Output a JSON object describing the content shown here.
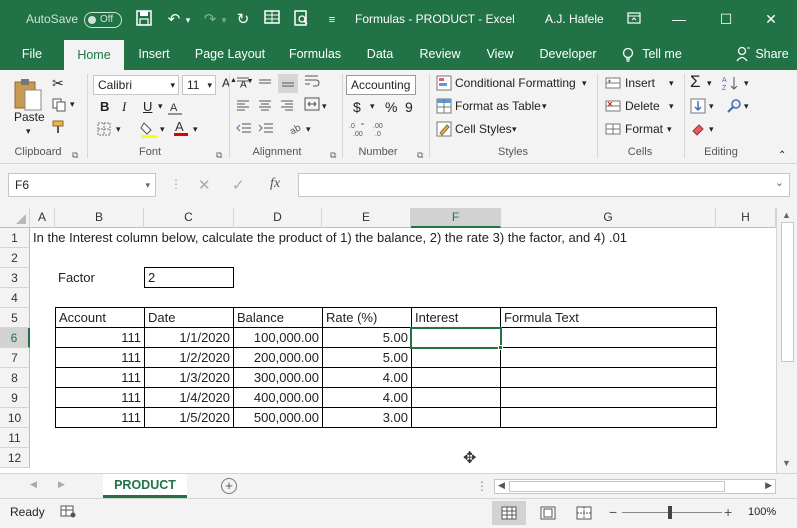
{
  "titlebar": {
    "autosave_label": "AutoSave",
    "autosave_state": "Off",
    "document_title": "Formulas - PRODUCT  -  Excel",
    "user": "A.J. Hafele"
  },
  "tabs": [
    {
      "label": "File"
    },
    {
      "label": "Home"
    },
    {
      "label": "Insert"
    },
    {
      "label": "Page Layout"
    },
    {
      "label": "Formulas"
    },
    {
      "label": "Data"
    },
    {
      "label": "Review"
    },
    {
      "label": "View"
    },
    {
      "label": "Developer"
    },
    {
      "label": "Tell me"
    },
    {
      "label": "Share"
    }
  ],
  "ribbon": {
    "clipboard": {
      "label": "Clipboard",
      "paste": "Paste"
    },
    "font": {
      "label": "Font",
      "name": "Calibri",
      "size": "11",
      "bold": "B",
      "italic": "I",
      "underline": "U"
    },
    "alignment": {
      "label": "Alignment"
    },
    "number": {
      "label": "Number",
      "format": "Accounting",
      "currency": "$",
      "percent": "%",
      "comma": "9"
    },
    "styles": {
      "label": "Styles",
      "conditional": "Conditional Formatting",
      "table": "Format as Table",
      "cell_styles": "Cell Styles"
    },
    "cells": {
      "label": "Cells",
      "insert": "Insert",
      "delete": "Delete",
      "format": "Format"
    },
    "editing": {
      "label": "Editing"
    }
  },
  "formula_bar": {
    "name_box": "F6",
    "fx": "fx",
    "content": ""
  },
  "columns": [
    "A",
    "B",
    "C",
    "D",
    "E",
    "F",
    "G",
    "H"
  ],
  "rows": [
    "1",
    "2",
    "3",
    "4",
    "5",
    "6",
    "7",
    "8",
    "9",
    "10",
    "11",
    "12"
  ],
  "sheet": {
    "instruction": "In the Interest column below, calculate the product of 1) the balance, 2) the rate 3) the factor, and 4) .01",
    "factor_label": "Factor",
    "factor_value": "2",
    "table_headers": [
      "Account",
      "Date",
      "Balance",
      "Rate (%)",
      "Interest",
      "Formula Text"
    ],
    "table_rows": [
      {
        "account": "111",
        "date": "1/1/2020",
        "balance": "100,000.00",
        "rate": "5.00",
        "interest": "",
        "formula": ""
      },
      {
        "account": "111",
        "date": "1/2/2020",
        "balance": "200,000.00",
        "rate": "5.00",
        "interest": "",
        "formula": ""
      },
      {
        "account": "111",
        "date": "1/3/2020",
        "balance": "300,000.00",
        "rate": "4.00",
        "interest": "",
        "formula": ""
      },
      {
        "account": "111",
        "date": "1/4/2020",
        "balance": "400,000.00",
        "rate": "4.00",
        "interest": "",
        "formula": ""
      },
      {
        "account": "111",
        "date": "1/5/2020",
        "balance": "500,000.00",
        "rate": "3.00",
        "interest": "",
        "formula": ""
      }
    ]
  },
  "sheet_tabs": [
    {
      "label": "PRODUCT"
    }
  ],
  "status": {
    "state": "Ready",
    "zoom": "100%"
  },
  "colors": {
    "brand": "#217346",
    "ribbon": "#f3f3f3",
    "selection": "#217346"
  }
}
